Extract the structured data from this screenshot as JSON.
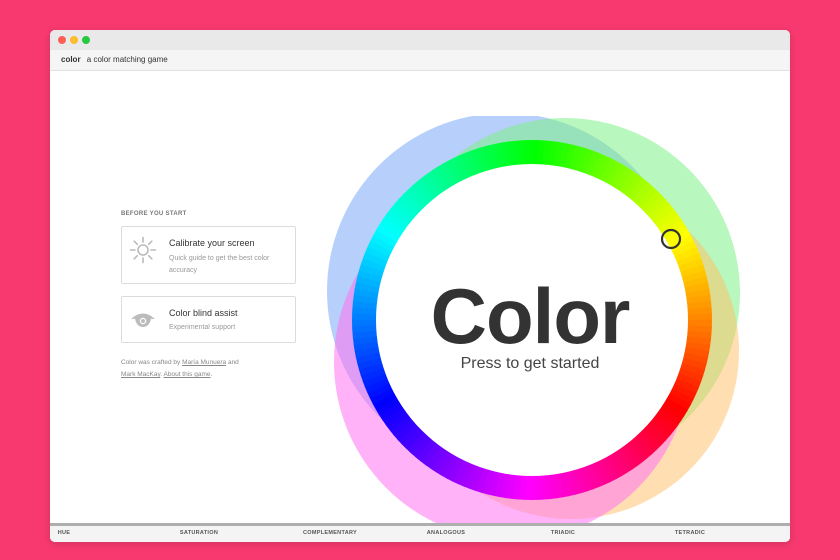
{
  "tab": {
    "brand": "color",
    "subtitle": "a color matching game"
  },
  "sidebar": {
    "section_title": "BEFORE YOU START",
    "cards": [
      {
        "title": "Calibrate your screen",
        "subtitle": "Quick guide to get the best color accuracy",
        "icon": "sun-icon"
      },
      {
        "title": "Color blind assist",
        "subtitle": "Experimental support",
        "icon": "eye-icon"
      }
    ],
    "credits": {
      "prefix": "Color was crafted by",
      "author1": "María Munuera",
      "and": "and",
      "author2": "Mark MacKay",
      "period": ".",
      "about": "About this game",
      "end": "."
    }
  },
  "main": {
    "title": "Color",
    "subtitle": "Press to get started"
  },
  "bottom_nav": [
    "HUE",
    "SATURATION",
    "COMPLEMENTARY",
    "ANALOGOUS",
    "TRIADIC",
    "TETRADIC"
  ],
  "colors": {
    "background": "#f7396f",
    "text": "#333333",
    "icon": "#bbbbbb"
  }
}
